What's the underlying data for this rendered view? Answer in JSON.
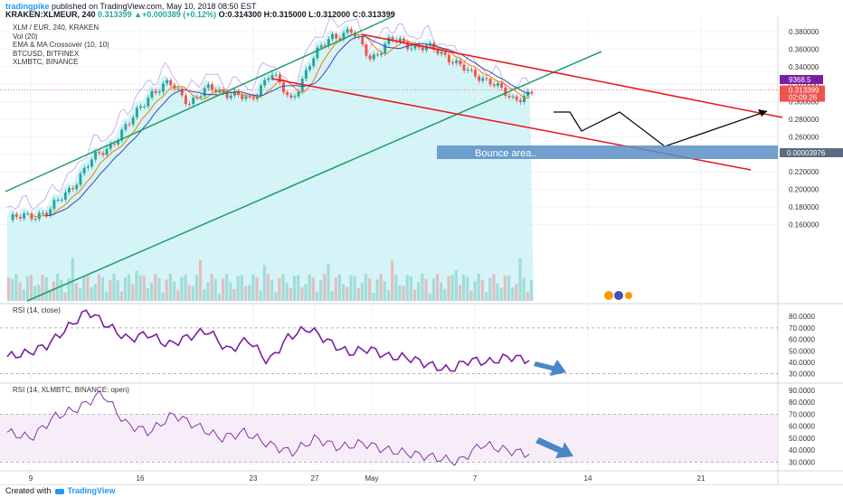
{
  "header": {
    "brand": "tradingpike",
    "published": "published on TradingView.com, May 10, 2018 08:50 EST",
    "symbol": "KRAKEN:XLMEUR, 240",
    "change": "0.313399 ▲+0.000389 (+0.12%)",
    "ohlc": "O:0.314300  H:0.315000  L:0.312000  C:0.313399"
  },
  "legend": {
    "items": [
      "XLM / EUR, 240, KRAKEN",
      "Vol (20)",
      "EMA & MA Crossover (10, 10)",
      "BTCUSD, BITFINEX",
      "XLMBTC, BINANCE"
    ]
  },
  "price_axis": {
    "ticks": [
      "0.380000",
      "0.360000",
      "0.340000",
      "0.320000",
      "0.300000",
      "0.280000",
      "0.260000",
      "0.240000",
      "0.220000",
      "0.200000",
      "0.180000",
      "0.160000"
    ],
    "current_price": "0.313399",
    "countdown": "02:09:26",
    "btc_label": "9368.5",
    "xlmbtc_label": "0.00003976"
  },
  "annotation": {
    "bounce": "Bounce area.."
  },
  "rsi1": {
    "title": "RSI (14, close)",
    "ticks": [
      "80.0000",
      "70.0000",
      "60.0000",
      "50.0000",
      "40.0000",
      "30.0000"
    ]
  },
  "rsi2": {
    "title": "RSI (14, XLMBTC, BINANCE: open)",
    "ticks": [
      "90.0000",
      "80.0000",
      "70.0000",
      "60.0000",
      "50.0000",
      "40.0000",
      "30.0000"
    ]
  },
  "time_axis": {
    "labels": [
      "9",
      "16",
      "23",
      "27",
      "May",
      "7",
      "14",
      "21"
    ]
  },
  "footer": {
    "created": "Created with",
    "tv": "TradingView"
  },
  "colors": {
    "up": "#26a69a",
    "down": "#ef5350",
    "channel_green": "#1e9e62",
    "channel_red": "#e8141a",
    "rsi": "#7b1fa2",
    "rsi_fill": "#f3e5f5",
    "area": "#b2ebf2",
    "bounce_box": "#5b8fc7",
    "arrow_blue": "#4a86c8"
  },
  "chart_data": {
    "type": "candlestick",
    "title": "XLM / EUR, 240, KRAKEN",
    "ylim": [
      0.145,
      0.39
    ],
    "x": [
      "9",
      "16",
      "23",
      "27",
      "May",
      "7",
      "14",
      "21"
    ],
    "price_levels": {
      "last": 0.313399,
      "open": 0.3143,
      "high": 0.315,
      "low": 0.312
    },
    "series": [
      {
        "name": "XLM / EUR",
        "close_path": [
          0.165,
          0.17,
          0.175,
          0.2,
          0.23,
          0.25,
          0.275,
          0.31,
          0.32,
          0.3,
          0.315,
          0.31,
          0.3,
          0.335,
          0.3,
          0.345,
          0.375,
          0.38,
          0.35,
          0.37,
          0.365,
          0.36,
          0.35,
          0.33,
          0.325,
          0.3,
          0.313
        ]
      },
      {
        "name": "RSI (14, close)",
        "ylim": [
          25,
          90
        ],
        "values": [
          45,
          48,
          55,
          70,
          85,
          72,
          60,
          65,
          55,
          62,
          68,
          50,
          60,
          40,
          62,
          70,
          58,
          48,
          52,
          45,
          44,
          38,
          33,
          42,
          40,
          45,
          42
        ]
      },
      {
        "name": "RSI (14, XLMBTC, BINANCE: open)",
        "ylim": [
          25,
          95
        ],
        "values": [
          55,
          50,
          68,
          75,
          88,
          62,
          55,
          70,
          60,
          50,
          55,
          45,
          38,
          50,
          42,
          46,
          40,
          37,
          34,
          30,
          45,
          40,
          37
        ]
      }
    ]
  }
}
